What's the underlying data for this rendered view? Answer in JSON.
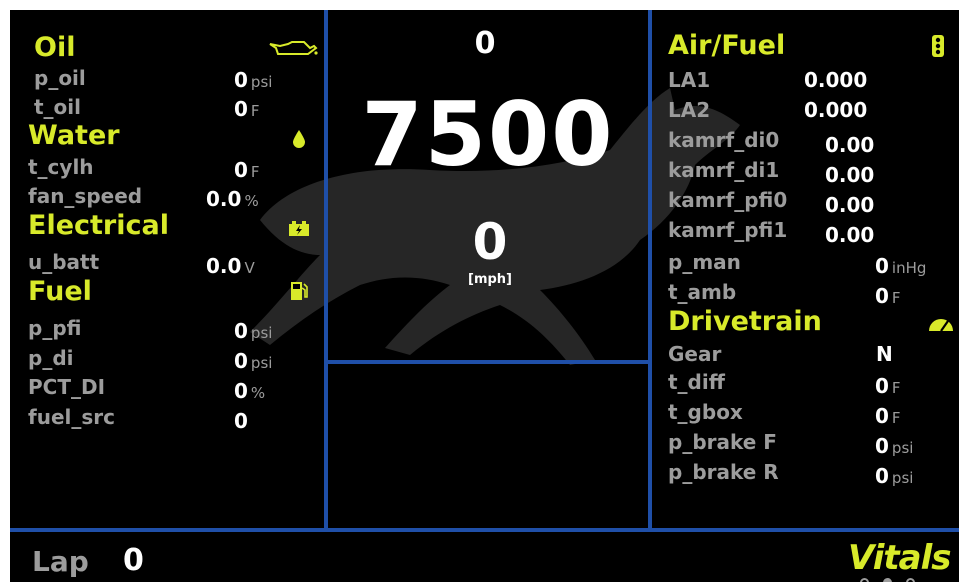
{
  "colors": {
    "accent": "#d8ea2a",
    "label": "#9c9c9c",
    "value": "#ffffff",
    "divider": "#1f4fa8",
    "background": "#000000"
  },
  "left": {
    "oil": {
      "title": "Oil",
      "icon": "oil-can-icon",
      "rows": [
        {
          "label": "p_oil",
          "value": "0",
          "unit": "psi"
        },
        {
          "label": "t_oil",
          "value": "0",
          "unit": "F"
        }
      ]
    },
    "water": {
      "title": "Water",
      "icon": "water-drop-icon",
      "rows": [
        {
          "label": "t_cylh",
          "value": "0",
          "unit": "F"
        },
        {
          "label": "fan_speed",
          "value": "0.0",
          "unit": "%"
        }
      ]
    },
    "electrical": {
      "title": "Electrical",
      "icon": "battery-icon",
      "rows": [
        {
          "label": "u_batt",
          "value": "0.0",
          "unit": "V"
        }
      ]
    },
    "fuel": {
      "title": "Fuel",
      "icon": "fuel-pump-icon",
      "rows": [
        {
          "label": "p_pfi",
          "value": "0",
          "unit": "psi"
        },
        {
          "label": "p_di",
          "value": "0",
          "unit": "psi"
        },
        {
          "label": "PCT_DI",
          "value": "0",
          "unit": "%"
        },
        {
          "label": "fuel_src",
          "value": "0",
          "unit": ""
        }
      ]
    }
  },
  "center": {
    "top_value": "0",
    "rpm": "7500",
    "speed": "0",
    "speed_unit": "[mph]",
    "background_icon": "mustang-horse-icon"
  },
  "right": {
    "airfuel": {
      "title": "Air/Fuel",
      "icon": "traffic-light-icon",
      "rows": [
        {
          "label": "LA1",
          "value": "0.000",
          "unit": ""
        },
        {
          "label": "LA2",
          "value": "0.000",
          "unit": ""
        },
        {
          "label": "kamrf_di0",
          "value": "0.00",
          "unit": ""
        },
        {
          "label": "kamrf_di1",
          "value": "0.00",
          "unit": ""
        },
        {
          "label": "kamrf_pfi0",
          "value": "0.00",
          "unit": ""
        },
        {
          "label": "kamrf_pfi1",
          "value": "0.00",
          "unit": ""
        },
        {
          "label": "p_man",
          "value": "0",
          "unit": "inHg"
        },
        {
          "label": "t_amb",
          "value": "0",
          "unit": "F"
        }
      ]
    },
    "drivetrain": {
      "title": "Drivetrain",
      "icon": "speedometer-icon",
      "rows": [
        {
          "label": "Gear",
          "value": "N",
          "unit": ""
        },
        {
          "label": "t_diff",
          "value": "0",
          "unit": "F"
        },
        {
          "label": "t_gbox",
          "value": "0",
          "unit": "F"
        },
        {
          "label": "p_brake F",
          "value": "0",
          "unit": "psi"
        },
        {
          "label": "p_brake R",
          "value": "0",
          "unit": "psi"
        }
      ]
    }
  },
  "footer": {
    "lap_label": "Lap",
    "lap_value": "0",
    "page_title": "Vitals",
    "page_dots": 3,
    "active_page": 1
  }
}
